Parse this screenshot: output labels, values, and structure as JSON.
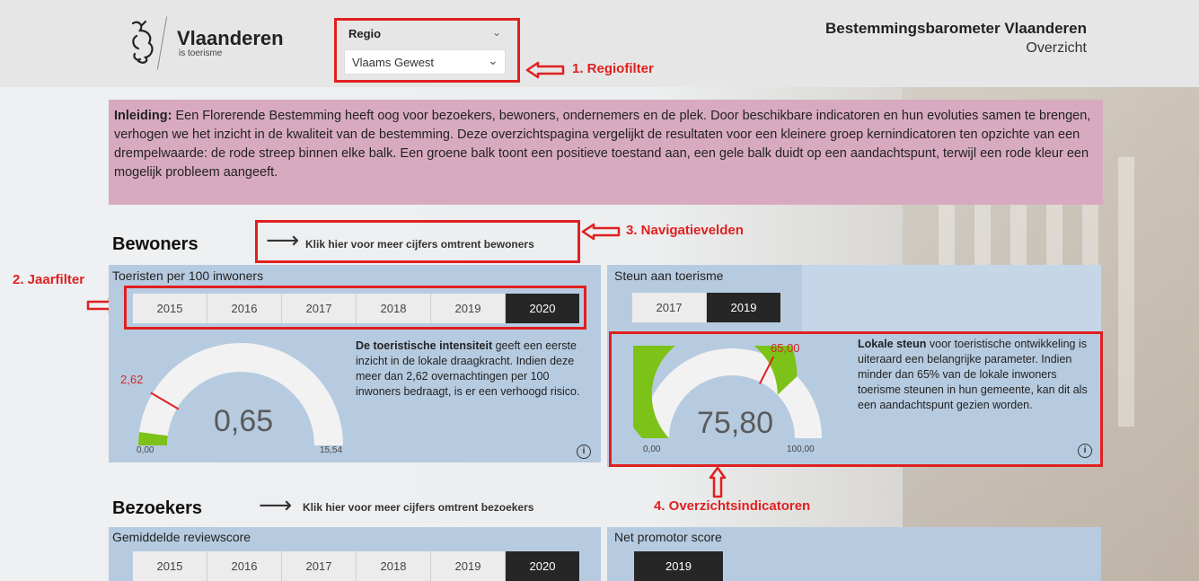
{
  "header": {
    "brand_title": "Vlaanderen",
    "brand_sub": "is toerisme",
    "region_label": "Regio",
    "region_value": "Vlaams Gewest",
    "app_title": "Bestemmingsbarometer Vlaanderen",
    "app_subtitle": "Overzicht"
  },
  "annotations": {
    "a1": "1. Regiofilter",
    "a2": "2. Jaarfilter",
    "a3": "3. Navigatievelden",
    "a4": "4. Overzichtsindicatoren"
  },
  "intro": {
    "lead": "Inleiding:",
    "text": " Een Florerende Bestemming heeft oog voor bezoekers, bewoners, ondernemers en de plek. Door beschikbare indicatoren en hun evoluties samen te brengen, verhogen we het inzicht in de kwaliteit van de bestemming. Deze overzichtspagina vergelijkt de resultaten voor een kleinere groep kernindicatoren ten opzichte van een drempelwaarde: de rode streep binnen elke balk. Een groene balk toont een positieve toestand aan, een gele balk duidt op een aandachtspunt, terwijl een rode kleur een mogelijk probleem aangeeft."
  },
  "bewoners": {
    "title": "Bewoners",
    "nav": "Klik hier voor meer cijfers omtrent bewoners",
    "tourists": {
      "title": "Toeristen per 100 inwoners",
      "years": [
        "2015",
        "2016",
        "2017",
        "2018",
        "2019",
        "2020"
      ],
      "selected": "2020",
      "value": "0,65",
      "value_num": 0.65,
      "min": "0,00",
      "max": "15,54",
      "min_num": 0,
      "max_num": 15.54,
      "target": "2,62",
      "target_num": 2.62,
      "color": "#7dc218",
      "desc_bold": "De toeristische intensiteit",
      "desc": " geeft een eerste inzicht in de lokale draagkracht. Indien deze meer dan 2,62 overnachtingen per 100 inwoners bedraagt, is er een verhoogd risico."
    },
    "support": {
      "title": "Steun aan toerisme",
      "years": [
        "2017",
        "2019"
      ],
      "selected": "2019",
      "value": "75,80",
      "value_num": 75.8,
      "min": "0,00",
      "max": "100,00",
      "min_num": 0,
      "max_num": 100,
      "target": "65,00",
      "target_num": 65,
      "color": "#7dc218",
      "desc_bold": "Lokale steun",
      "desc": " voor toeristische ontwikkeling is uiteraard een belangrijke parameter. Indien minder dan 65% van de lokale inwoners toerisme steunen in hun gemeente, kan dit als een aandachtspunt gezien worden."
    }
  },
  "bezoekers": {
    "title": "Bezoekers",
    "nav": "Klik hier voor meer cijfers omtrent bezoekers",
    "reviews": {
      "title": "Gemiddelde reviewscore",
      "years": [
        "2015",
        "2016",
        "2017",
        "2018",
        "2019",
        "2020"
      ],
      "selected": "2020"
    },
    "nps": {
      "title": "Net promotor score",
      "years": [
        "2019"
      ],
      "selected": "2019"
    }
  },
  "info_symbol": "i"
}
